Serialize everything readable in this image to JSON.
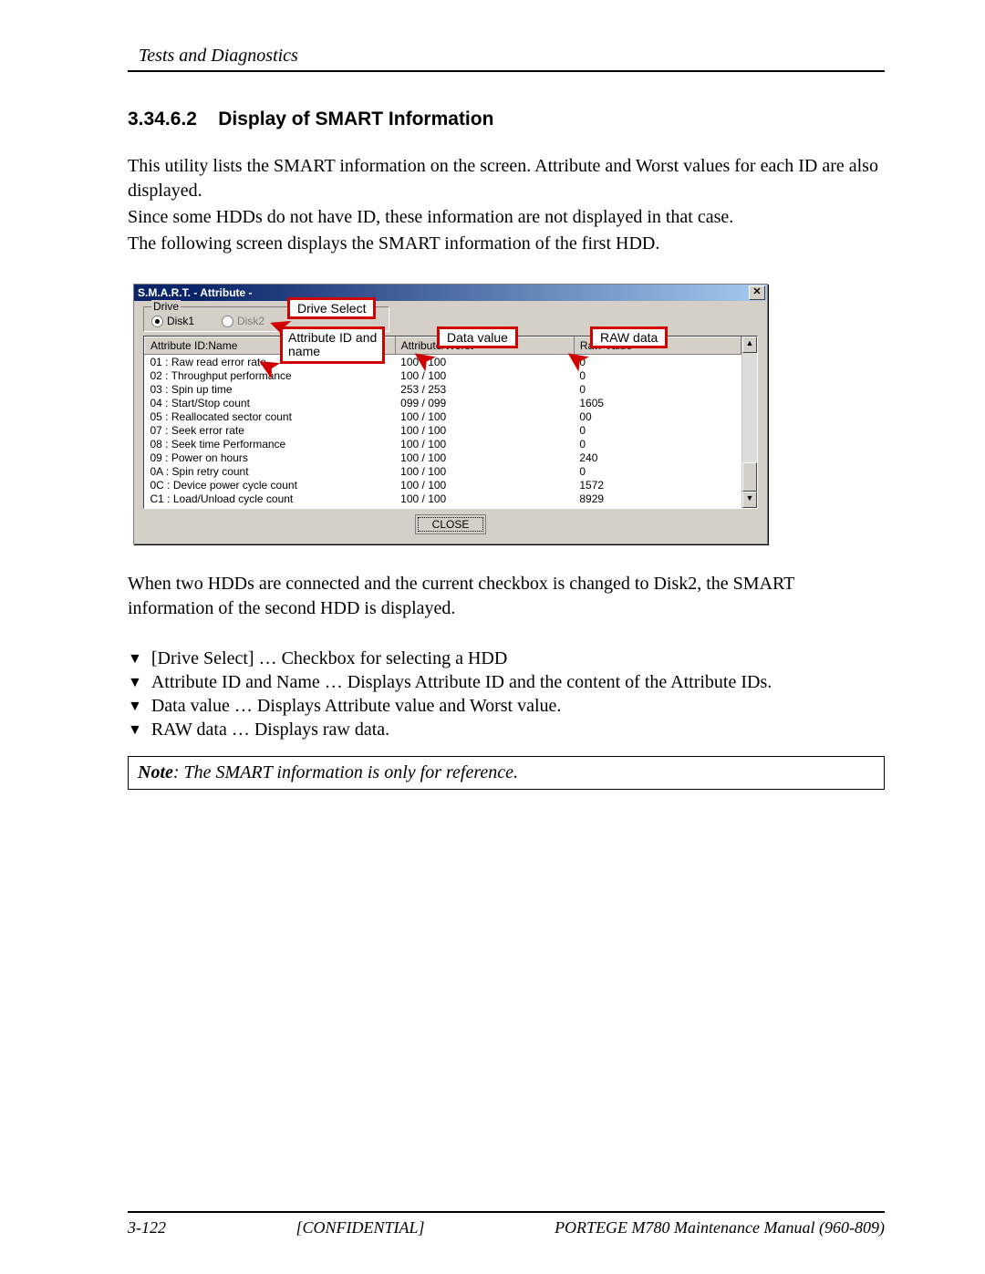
{
  "header": {
    "running": "Tests and Diagnostics"
  },
  "section": {
    "number": "3.34.6.2",
    "title": "Display of SMART Information"
  },
  "paragraphs": {
    "p1": "This utility lists the SMART information on the screen. Attribute and Worst values for each ID are also displayed.",
    "p2": "Since some HDDs do not have ID, these information are not displayed in that case.",
    "p3": "The following screen displays the SMART information of the first HDD.",
    "after": "When two HDDs are connected and the current checkbox is changed to Disk2, the SMART information of the second HDD is displayed."
  },
  "window": {
    "title": "S.M.A.R.T. - Attribute -",
    "close_x": "✕",
    "drive_legend": "Drive",
    "disk1": "Disk1",
    "disk2": "Disk2",
    "col_a": "Attribute ID:Name",
    "col_b": "Attribute/Worst",
    "col_c": "Raw Value",
    "close_btn": "CLOSE",
    "rows": [
      {
        "a": "01 : Raw read error rate",
        "b": "100 / 100",
        "c": "0"
      },
      {
        "a": "02 : Throughput performance",
        "b": "100 / 100",
        "c": "0"
      },
      {
        "a": "03 : Spin up time",
        "b": "253 / 253",
        "c": "0"
      },
      {
        "a": "04 : Start/Stop count",
        "b": "099 / 099",
        "c": "1605"
      },
      {
        "a": "05 : Reallocated sector count",
        "b": "100 / 100",
        "c": "00"
      },
      {
        "a": "07 : Seek error rate",
        "b": "100 / 100",
        "c": "0"
      },
      {
        "a": "08 : Seek time Performance",
        "b": "100 / 100",
        "c": "0"
      },
      {
        "a": "09 : Power on hours",
        "b": "100 / 100",
        "c": "240"
      },
      {
        "a": "0A : Spin retry count",
        "b": "100 / 100",
        "c": "0"
      },
      {
        "a": "0C : Device power cycle count",
        "b": "100 / 100",
        "c": "1572"
      },
      {
        "a": "C1 : Load/Unload cycle count",
        "b": "100 / 100",
        "c": "8929"
      }
    ]
  },
  "callouts": {
    "drive_select": "Drive Select",
    "attr_id_name_l1": "Attribute ID and",
    "attr_id_name_l2": "name",
    "data_value": "Data value",
    "raw_data": "RAW data"
  },
  "bullets": [
    "[Drive Select] … Checkbox for selecting a HDD",
    "Attribute ID and Name … Displays Attribute ID and the content of the Attribute IDs.",
    "Data value … Displays Attribute value and Worst value.",
    "RAW data … Displays raw data."
  ],
  "note": {
    "label": "Note",
    "text": ": The SMART information is only for reference."
  },
  "footer": {
    "page": "3-122",
    "conf": "[CONFIDENTIAL]",
    "manual": "PORTEGE M780 Maintenance Manual (960-809)"
  }
}
